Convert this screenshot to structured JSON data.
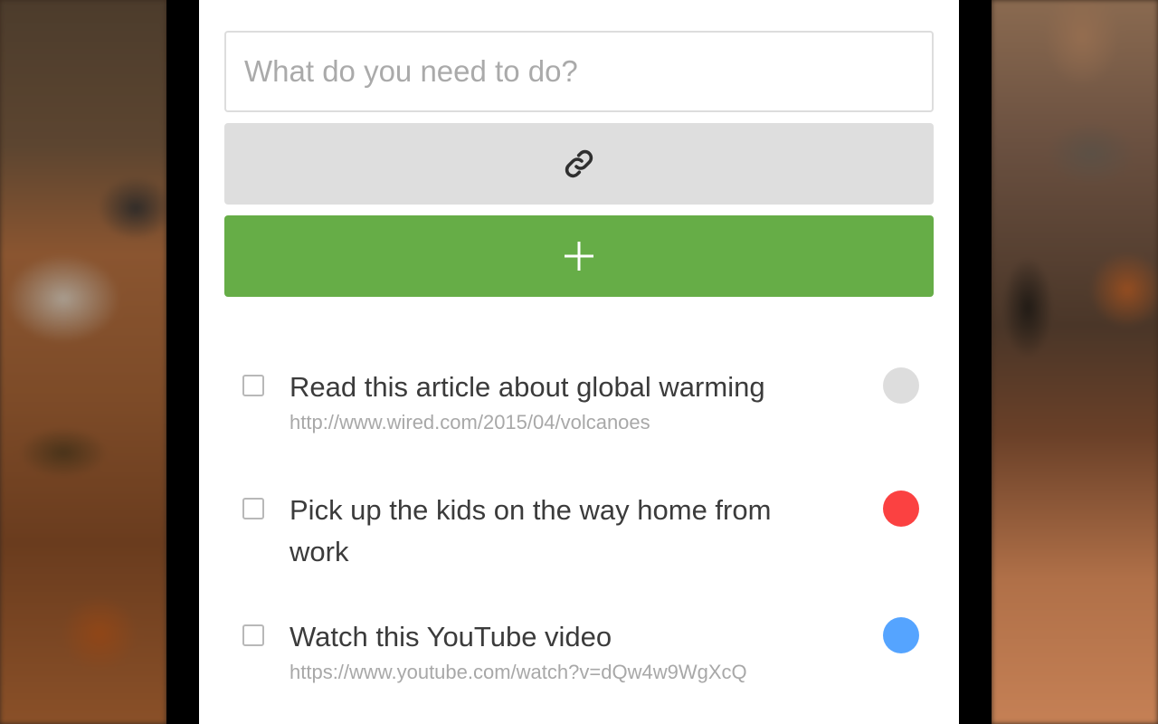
{
  "new_task": {
    "placeholder": "What do you need to do?",
    "value": ""
  },
  "toolbar": {
    "link_icon": "link-icon",
    "add_icon": "plus-icon"
  },
  "colors": {
    "add_button": "#66ad47",
    "link_button": "#dedede",
    "priority_none": "#dddddd",
    "priority_high": "#fb4141",
    "priority_low": "#55a4ff"
  },
  "tasks": [
    {
      "title": "Read this article about global warming",
      "url": "http://www.wired.com/2015/04/volcanoes",
      "priority_color": "#dddddd",
      "checked": false
    },
    {
      "title": "Pick up the kids on the way home from work",
      "url": "",
      "priority_color": "#fb4141",
      "checked": false
    },
    {
      "title": "Watch this YouTube video",
      "url": "https://www.youtube.com/watch?v=dQw4w9WgXcQ",
      "priority_color": "#55a4ff",
      "checked": false
    }
  ]
}
